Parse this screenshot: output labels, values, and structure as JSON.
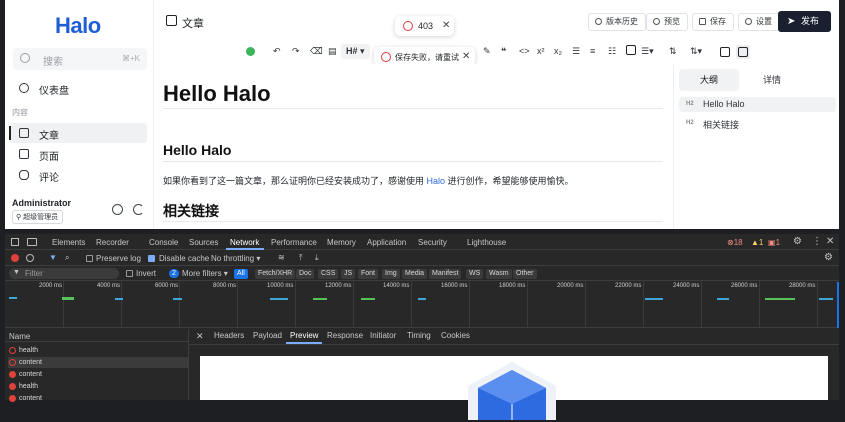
{
  "app": {
    "logo": "Halo",
    "search": {
      "placeholder": "搜索",
      "shortcut": "⌘+K"
    },
    "nav": {
      "dashboard": "仪表盘",
      "section": "内容",
      "posts": "文章",
      "pages": "页面",
      "comments": "评论"
    },
    "user": {
      "name": "Administrator",
      "role": "超级管理员"
    },
    "title": "文章",
    "status_code": "403",
    "error_toast": "保存失败，请重试",
    "buttons": {
      "history": "版本历史",
      "preview": "预览",
      "save": "保存",
      "settings": "设置",
      "publish": "发布"
    },
    "toolbar": {
      "heading": "H#"
    },
    "editor": {
      "h1": "Hello Halo",
      "h2a": "Hello Halo",
      "para_pre": "如果你看到了这一篇文章，那么证明你已经安装成功了，感谢使用 ",
      "para_link": "Halo",
      "para_post": " 进行创作，希望能够使用愉快。",
      "h2b": "相关链接"
    },
    "right_panel": {
      "tab_outline": "大纲",
      "tab_detail": "详情",
      "outline": [
        {
          "level": "H2",
          "text": "Hello Halo"
        },
        {
          "level": "H2",
          "text": "相关链接"
        }
      ]
    }
  },
  "devtools": {
    "tabs": [
      "Elements",
      "Recorder",
      "Console",
      "Sources",
      "Network",
      "Performance",
      "Memory",
      "Application",
      "Security",
      "Lighthouse"
    ],
    "active_tab": "Network",
    "errors": "18",
    "warnings": "1",
    "issues": "1",
    "preserve_log": "Preserve log",
    "disable_cache": "Disable cache",
    "throttling": "No throttling",
    "filter_placeholder": "Filter",
    "invert": "Invert",
    "more_filters_count": "2",
    "more_filters": "More filters",
    "chips": [
      "All",
      "Fetch/XHR",
      "Doc",
      "CSS",
      "JS",
      "Font",
      "Img",
      "Media",
      "Manifest",
      "WS",
      "Wasm",
      "Other"
    ],
    "ticks": [
      "2000 ms",
      "4000 ms",
      "6000 ms",
      "8000 ms",
      "10000 ms",
      "12000 ms",
      "14000 ms",
      "16000 ms",
      "18000 ms",
      "20000 ms",
      "22000 ms",
      "24000 ms",
      "26000 ms",
      "28000 ms"
    ],
    "name_header": "Name",
    "requests": [
      "health",
      "content",
      "content",
      "health",
      "content"
    ],
    "panel_tabs": [
      "Headers",
      "Payload",
      "Preview",
      "Response",
      "Initiator",
      "Timing",
      "Cookies"
    ],
    "active_panel_tab": "Preview"
  },
  "colors": {
    "brand": "#1f5fd6",
    "error": "#e0393e",
    "devtools_accent": "#1a73e8"
  }
}
